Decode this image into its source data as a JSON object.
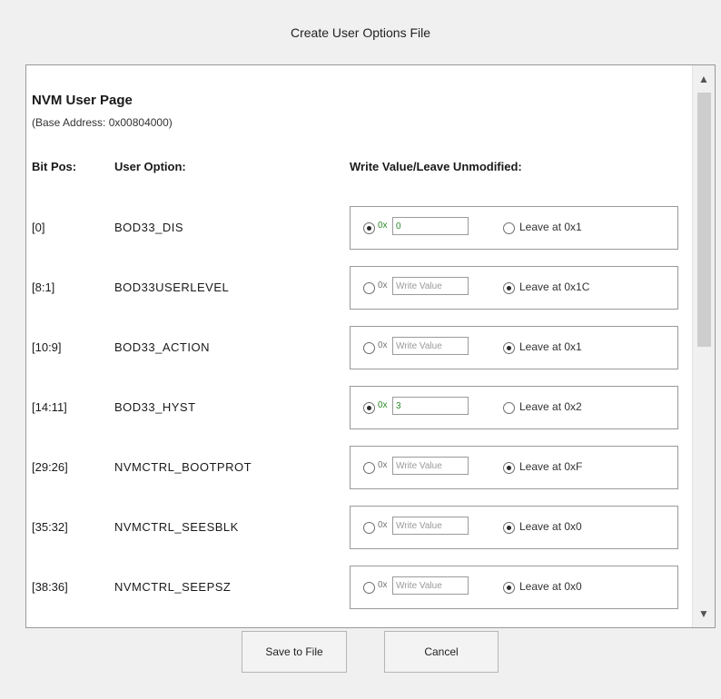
{
  "dialog": {
    "title": "Create User Options File"
  },
  "section": {
    "title": "NVM User Page",
    "base_address": "(Base Address: 0x00804000)"
  },
  "columns": {
    "bit_pos": "Bit Pos:",
    "user_option": "User Option:",
    "write_value": "Write Value/Leave Unmodified:"
  },
  "rows": [
    {
      "bit_pos": "[0]",
      "option": "BOD33_DIS",
      "mode": "write",
      "hex_prefix": "0x",
      "value": "0",
      "leave_label": "Leave at 0x1"
    },
    {
      "bit_pos": "[8:1]",
      "option": "BOD33USERLEVEL",
      "mode": "leave",
      "hex_prefix": "0x",
      "value": "Write Value",
      "leave_label": "Leave at 0x1C"
    },
    {
      "bit_pos": "[10:9]",
      "option": "BOD33_ACTION",
      "mode": "leave",
      "hex_prefix": "0x",
      "value": "Write Value",
      "leave_label": "Leave at 0x1"
    },
    {
      "bit_pos": "[14:11]",
      "option": "BOD33_HYST",
      "mode": "write",
      "hex_prefix": "0x",
      "value": "3",
      "leave_label": "Leave at 0x2"
    },
    {
      "bit_pos": "[29:26]",
      "option": "NVMCTRL_BOOTPROT",
      "mode": "leave",
      "hex_prefix": "0x",
      "value": "Write Value",
      "leave_label": "Leave at 0xF"
    },
    {
      "bit_pos": "[35:32]",
      "option": "NVMCTRL_SEESBLK",
      "mode": "leave",
      "hex_prefix": "0x",
      "value": "Write Value",
      "leave_label": "Leave at 0x0"
    },
    {
      "bit_pos": "[38:36]",
      "option": "NVMCTRL_SEEPSZ",
      "mode": "leave",
      "hex_prefix": "0x",
      "value": "Write Value",
      "leave_label": "Leave at 0x0"
    }
  ],
  "buttons": {
    "save": "Save to File",
    "cancel": "Cancel"
  },
  "icons": {
    "scroll_up": "▲",
    "scroll_down": "▼"
  }
}
